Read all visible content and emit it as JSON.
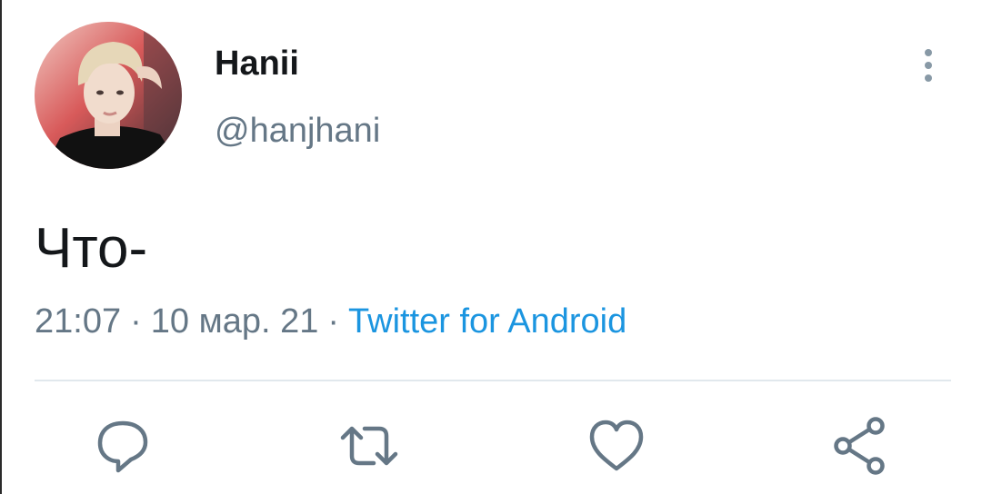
{
  "tweet": {
    "author": {
      "display_name": "Hanii",
      "handle": "@hanjhani"
    },
    "text": "Что-",
    "time": "21:07",
    "date": "10 мар. 21",
    "separator": "·",
    "source": "Twitter for Android"
  },
  "actions": {
    "reply": "reply-icon",
    "retweet": "retweet-icon",
    "like": "heart-icon",
    "share": "share-icon"
  },
  "colors": {
    "text": "#14171a",
    "secondary": "#657786",
    "link": "#1b95e0",
    "divider": "#e1e8ed"
  }
}
